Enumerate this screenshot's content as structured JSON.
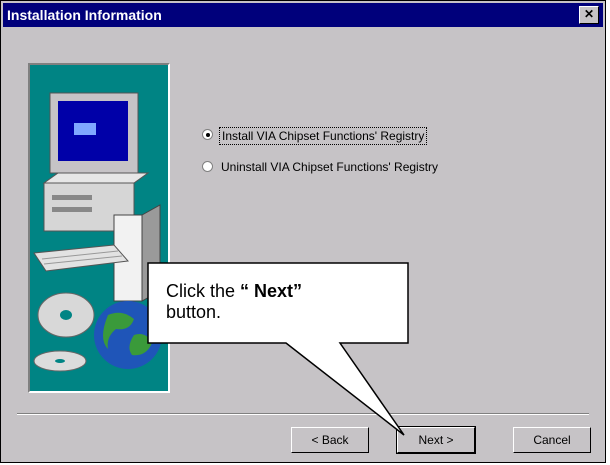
{
  "window": {
    "title": "Installation Information"
  },
  "options": [
    {
      "label": "Install VIA Chipset Functions' Registry",
      "checked": true
    },
    {
      "label": "Uninstall VIA Chipset Functions' Registry",
      "checked": false
    }
  ],
  "buttons": {
    "back": "< Back",
    "next": "Next >",
    "cancel": "Cancel"
  },
  "callout": {
    "prefix": "Click the ",
    "bold": "“ Next”",
    "suffix": "button."
  },
  "colors": {
    "titlebar": "#00007b",
    "dialog": "#c6c3c6",
    "side_panel": "#008484"
  }
}
